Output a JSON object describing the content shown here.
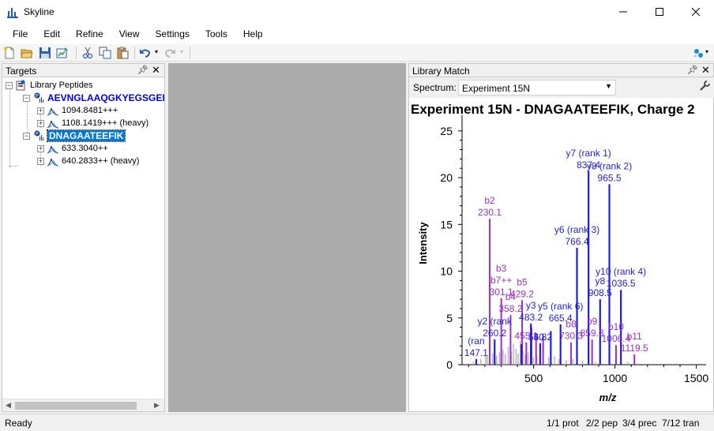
{
  "window": {
    "title": "Skyline"
  },
  "menu": {
    "items": [
      "File",
      "Edit",
      "Refine",
      "View",
      "Settings",
      "Tools",
      "Help"
    ]
  },
  "toolbar": {
    "icons": [
      "new-icon",
      "open-icon",
      "save-icon",
      "publish-icon",
      "cut-icon",
      "copy-icon",
      "paste-icon",
      "undo-icon",
      "redo-icon",
      "integrate-icon"
    ]
  },
  "targets": {
    "panel_title": "Targets",
    "tree": {
      "root_label": "Library Peptides",
      "peptides": [
        {
          "label": "AEVNGLAAQGKYEGSGEI",
          "precursors": [
            "1094.8481+++",
            "1108.1419+++ (heavy)"
          ]
        },
        {
          "label": "DNAGAATEEFIK",
          "selected": true,
          "precursors": [
            "633.3040++",
            "640.2833++ (heavy)"
          ]
        }
      ]
    }
  },
  "library_match": {
    "panel_title": "Library Match",
    "spectrum_label": "Spectrum:",
    "spectrum_value": "Experiment 15N"
  },
  "chart_data": {
    "type": "bar",
    "title": "Experiment 15N - DNAGAATEEFIK, Charge 2",
    "xlabel": "m/z",
    "ylabel": "Intensity",
    "xlim": [
      60,
      1560
    ],
    "ylim": [
      0,
      26
    ],
    "xticks": [
      500,
      1000,
      1500
    ],
    "yticks": [
      0,
      5,
      10,
      15,
      20,
      25
    ],
    "grid": false,
    "peaks_unmatched": [
      {
        "x": 130,
        "y": 0.3
      },
      {
        "x": 175,
        "y": 0.6
      },
      {
        "x": 205,
        "y": 0.9
      },
      {
        "x": 215,
        "y": 1.0
      },
      {
        "x": 248,
        "y": 1.2
      },
      {
        "x": 272,
        "y": 1.0
      },
      {
        "x": 290,
        "y": 1.3
      },
      {
        "x": 312,
        "y": 1.6
      },
      {
        "x": 326,
        "y": 1.1
      },
      {
        "x": 344,
        "y": 1.9
      },
      {
        "x": 362,
        "y": 1.4
      },
      {
        "x": 376,
        "y": 2.2
      },
      {
        "x": 392,
        "y": 1.7
      },
      {
        "x": 405,
        "y": 1.2
      },
      {
        "x": 418,
        "y": 2.6
      },
      {
        "x": 433,
        "y": 1.5
      },
      {
        "x": 448,
        "y": 1.1
      },
      {
        "x": 466,
        "y": 1.3
      },
      {
        "x": 482,
        "y": 1.0
      },
      {
        "x": 498,
        "y": 0.8
      },
      {
        "x": 520,
        "y": 0.9
      },
      {
        "x": 558,
        "y": 1.5
      },
      {
        "x": 592,
        "y": 0.8
      },
      {
        "x": 628,
        "y": 0.9
      },
      {
        "x": 655,
        "y": 0.6
      },
      {
        "x": 700,
        "y": 0.5
      },
      {
        "x": 742,
        "y": 0.6
      },
      {
        "x": 800,
        "y": 0.4
      },
      {
        "x": 880,
        "y": 0.3
      },
      {
        "x": 1080,
        "y": 0.3
      }
    ],
    "peaks_b": [
      {
        "x": 230.1,
        "y": 15.6
      },
      {
        "x": 301.1,
        "y": 7.1
      },
      {
        "x": 358.2,
        "y": 5.3
      },
      {
        "x": 429.2,
        "y": 6.9
      },
      {
        "x": 487.2,
        "y": 4.0
      },
      {
        "x": 558.2,
        "y": 3.0
      },
      {
        "x": 730.3,
        "y": 2.4
      },
      {
        "x": 859.3,
        "y": 2.7
      },
      {
        "x": 1006.4,
        "y": 2.1
      },
      {
        "x": 1119.5,
        "y": 1.1
      },
      {
        "x": 455.0,
        "y": 2.4
      },
      {
        "x": 515.0,
        "y": 3.3
      }
    ],
    "peaks_y": [
      {
        "x": 147.1,
        "y": 0.6
      },
      {
        "x": 260.2,
        "y": 2.7
      },
      {
        "x": 425.2,
        "y": 2.2
      },
      {
        "x": 483.2,
        "y": 4.4
      },
      {
        "x": 540.2,
        "y": 2.3
      },
      {
        "x": 665.4,
        "y": 4.3
      },
      {
        "x": 766.4,
        "y": 12.5
      },
      {
        "x": 837.4,
        "y": 20.7
      },
      {
        "x": 908.5,
        "y": 7.0
      },
      {
        "x": 965.5,
        "y": 19.3
      },
      {
        "x": 1036.5,
        "y": 8.0
      },
      {
        "x": 605.3,
        "y": 3.6
      }
    ],
    "labels": [
      {
        "x": 837.4,
        "y": 20.7,
        "lines": [
          "y7 (rank 1)",
          "837.4"
        ],
        "color": "#1f1fd8"
      },
      {
        "x": 965.5,
        "y": 19.3,
        "lines": [
          "y8 (rank 2)",
          "965.5"
        ],
        "color": "#1f1fd8"
      },
      {
        "x": 766.4,
        "y": 12.5,
        "lines": [
          "y6 (rank 3)",
          "766.4"
        ],
        "color": "#1f1fd8"
      },
      {
        "x": 1036.5,
        "y": 8.0,
        "lines": [
          "y10 (rank 4)",
          "1036.5"
        ],
        "color": "#1f1fd8"
      },
      {
        "x": 908.5,
        "y": 7.0,
        "lines": [
          "y8",
          "908.5"
        ],
        "color": "#1f1fd8"
      },
      {
        "x": 665.4,
        "y": 4.3,
        "lines": [
          "y5 (rank 6)",
          "665.4"
        ],
        "color": "#1f1fd8"
      },
      {
        "x": 483.2,
        "y": 4.4,
        "lines": [
          "y3",
          "483.2"
        ],
        "color": "#1f1fd8"
      },
      {
        "x": 230.1,
        "y": 15.6,
        "lines": [
          "b2",
          "230.1"
        ],
        "color": "#9b2fc9"
      },
      {
        "x": 301.1,
        "y": 7.1,
        "lines": [
          "b3",
          "b7++",
          "301.1"
        ],
        "color": "#9b2fc9"
      },
      {
        "x": 429.2,
        "y": 6.9,
        "lines": [
          "b5",
          "429.2"
        ],
        "color": "#9b2fc9"
      },
      {
        "x": 358.2,
        "y": 5.3,
        "lines": [
          "b4",
          "358.2"
        ],
        "color": "#9b2fc9"
      },
      {
        "x": 260.2,
        "y": 2.7,
        "lines": [
          "y2 (rank",
          "260.2"
        ],
        "color": "#1f1fd8"
      },
      {
        "x": 147.1,
        "y": 0.6,
        "lines": [
          "(ran",
          "147.1"
        ],
        "color": "#1f1fd8"
      },
      {
        "x": 730.3,
        "y": 2.4,
        "lines": [
          "b8",
          "730.3"
        ],
        "color": "#9b2fc9"
      },
      {
        "x": 859.3,
        "y": 2.7,
        "lines": [
          "b9",
          "859.3"
        ],
        "color": "#9b2fc9"
      },
      {
        "x": 1006.4,
        "y": 2.1,
        "lines": [
          "b10",
          "1006.4"
        ],
        "color": "#9b2fc9"
      },
      {
        "x": 1119.5,
        "y": 1.1,
        "lines": [
          "b11",
          "1119.5"
        ],
        "color": "#9b2fc9"
      },
      {
        "x": 540.2,
        "y": 2.3,
        "lines": [
          "540.2"
        ],
        "color": "#1f1fd8"
      },
      {
        "x": 455.0,
        "y": 2.4,
        "lines": [
          "455.1"
        ],
        "color": "#9b2fc9"
      },
      {
        "x": 540.2,
        "y": 2.3,
        "lines": [
          "5.8"
        ],
        "color": "#1f1fd8"
      }
    ],
    "colors": {
      "b_ion": "#9b2fc9",
      "y_ion": "#1f1fd8",
      "unmatched": "#b4b4b4"
    }
  },
  "status": {
    "ready": "Ready",
    "prot": "1/1 prot",
    "pep": "2/2 pep",
    "prec": "3/4 prec",
    "tran": "7/12 tran"
  }
}
